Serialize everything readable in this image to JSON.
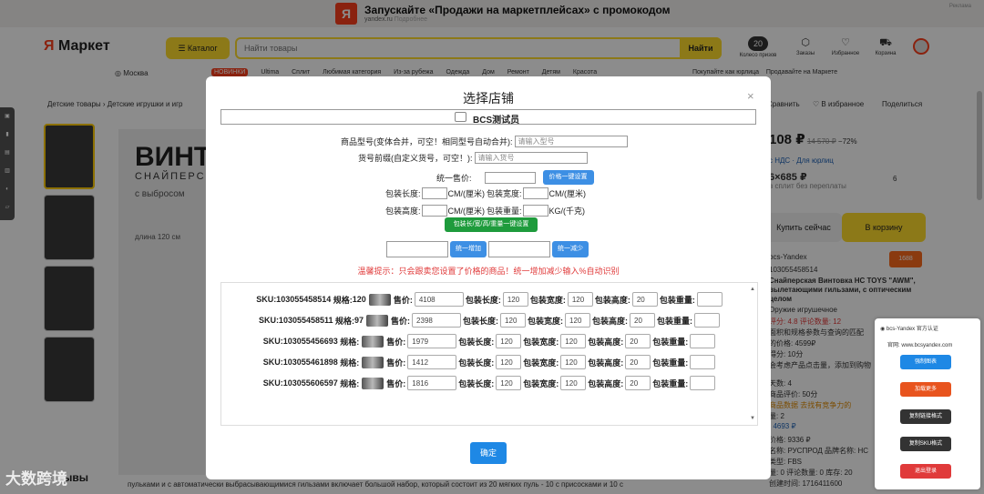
{
  "ad": {
    "logo": "Я",
    "title": "Запускайте «Продажи на маркетплейсах» с промокодом",
    "domain": "yandex.ru",
    "more": "Подробнее",
    "corner": "Реклама"
  },
  "header": {
    "logo_ya": "Я",
    "logo_text": "Маркет",
    "catalog": "Каталог",
    "search_placeholder": "Найти товары",
    "search_button": "Найти",
    "coins_value": "20",
    "coins_label": "Колесо призов",
    "orders": "Заказы",
    "favorites": "Избранное",
    "cart": "Корзина",
    "city": "Москва",
    "nav": [
      "Ultima",
      "Сплит",
      "Любимая категория",
      "Из-за рубежа",
      "Одежда",
      "Дом",
      "Ремонт",
      "Детям",
      "Красота"
    ],
    "nav_hot": "НОВИНКИ",
    "nav_right_1": "Покупайте как юрлица",
    "nav_right_2": "Продавайте на Маркете"
  },
  "breadcrumb": [
    "Детские товары",
    "Детские игрушки и игр"
  ],
  "product_image": {
    "title": "ВИНТ",
    "line1": "СНАЙПЕРС",
    "line2": "с выбросом",
    "line3": "длина 120 см"
  },
  "reviews_label": "Отзывы",
  "footer_snippet": "пульками и с автоматически выбрасывающимися гильзами включает большой набор, который состоит из 20 мягких пуль - 10 с присосками и 10 с",
  "watermark": "大数跨境",
  "right_col": {
    "compare": "Сравнить",
    "favorite": "В избранное",
    "share": "Поделиться",
    "price": "108 ₽",
    "old_price": "14 570 ₽",
    "discount": "−72%",
    "price_note": "с НДС · Для юрлиц",
    "installments": "6×685 ₽",
    "installments_note": "в сплит без переплаты",
    "installments_count": "6",
    "buy_now": "Купить сейчас",
    "add_to_cart": "В корзину",
    "seller": "bcs-Yandex",
    "seller_badge": "1688",
    "lines": [
      "103055458514",
      "Снайперская Винтовка HC TOYS \"AWM\",",
      "вылетающими гильзами, с оптическим",
      "целом",
      "Оружие игрушечное",
      "评分: 4.8  评论数量: 12",
      "面积和规格参数与查询的匹配",
      "的价格: 4599₽",
      "得分: 10分",
      "会考虑产品点击量，添加到购物",
      "天数: 4",
      "商品评价: 50分",
      "商品数据  去找有竞争力的",
      "量: 2",
      ": 4693 ₽",
      "价格: 9336 ₽",
      "名称: РУСПРОД 品牌名称: НС",
      "类型: FBS",
      "量: 0 评论数量: 0 库存: 20",
      "创建时间: 1716411600"
    ]
  },
  "plugin": {
    "header": "bcs-Yandex 官方认证",
    "url_label": "官网: www.bcsyandex.com",
    "buttons": [
      "强制图表",
      "加载更多",
      "复制链接格式",
      "复制SKU格式",
      "退出登录"
    ]
  },
  "modal": {
    "title": "选择店铺",
    "close": "×",
    "store_name": "BCS测试员",
    "model_label": "商品型号(变体合并，可空！相同型号自动合并):",
    "model_placeholder": "请输入型号",
    "sku_prefix_label": "货号前缀(自定义货号，可空！):",
    "sku_prefix_placeholder": "请输入货号",
    "unified_price_label": "统一售价:",
    "price_set_button": "价格一键设置",
    "pkg_length": "包装长度:",
    "pkg_width": "包装宽度:",
    "pkg_height": "包装高度:",
    "pkg_weight": "包装重量:",
    "unit_cm": "CM/(厘米)",
    "unit_kg": "KG/(千克)",
    "dims_set_button": "包装长/宽/高/重量一键设置",
    "increase_button": "统一增加",
    "decrease_button": "统一减少",
    "warning": "温馨提示：只会跟卖您设置了价格的商品！统一增加减少输入%自动识别",
    "confirm": "确定",
    "spec_label": "规格:",
    "price_label": "售价:",
    "skus": [
      {
        "sku": "SKU:103055458514",
        "spec": "120",
        "price": "4108",
        "length": "120",
        "width": "120",
        "height": "20",
        "weight": ""
      },
      {
        "sku": "SKU:103055458511",
        "spec": "97",
        "price": "2398",
        "length": "120",
        "width": "120",
        "height": "20",
        "weight": ""
      },
      {
        "sku": "SKU:103055456693",
        "spec": "",
        "price": "1979",
        "length": "120",
        "width": "120",
        "height": "20",
        "weight": ""
      },
      {
        "sku": "SKU:103055461898",
        "spec": "",
        "price": "1412",
        "length": "120",
        "width": "120",
        "height": "20",
        "weight": ""
      },
      {
        "sku": "SKU:103055606597",
        "spec": "",
        "price": "1816",
        "length": "120",
        "width": "120",
        "height": "20",
        "weight": ""
      }
    ]
  },
  "colors": {
    "brand_yellow": "#ffdd2d",
    "brand_red": "#fc3f1d",
    "button_blue": "#3d8fe4",
    "button_green": "#1e9b3c",
    "warning_red": "#e03a3a"
  }
}
